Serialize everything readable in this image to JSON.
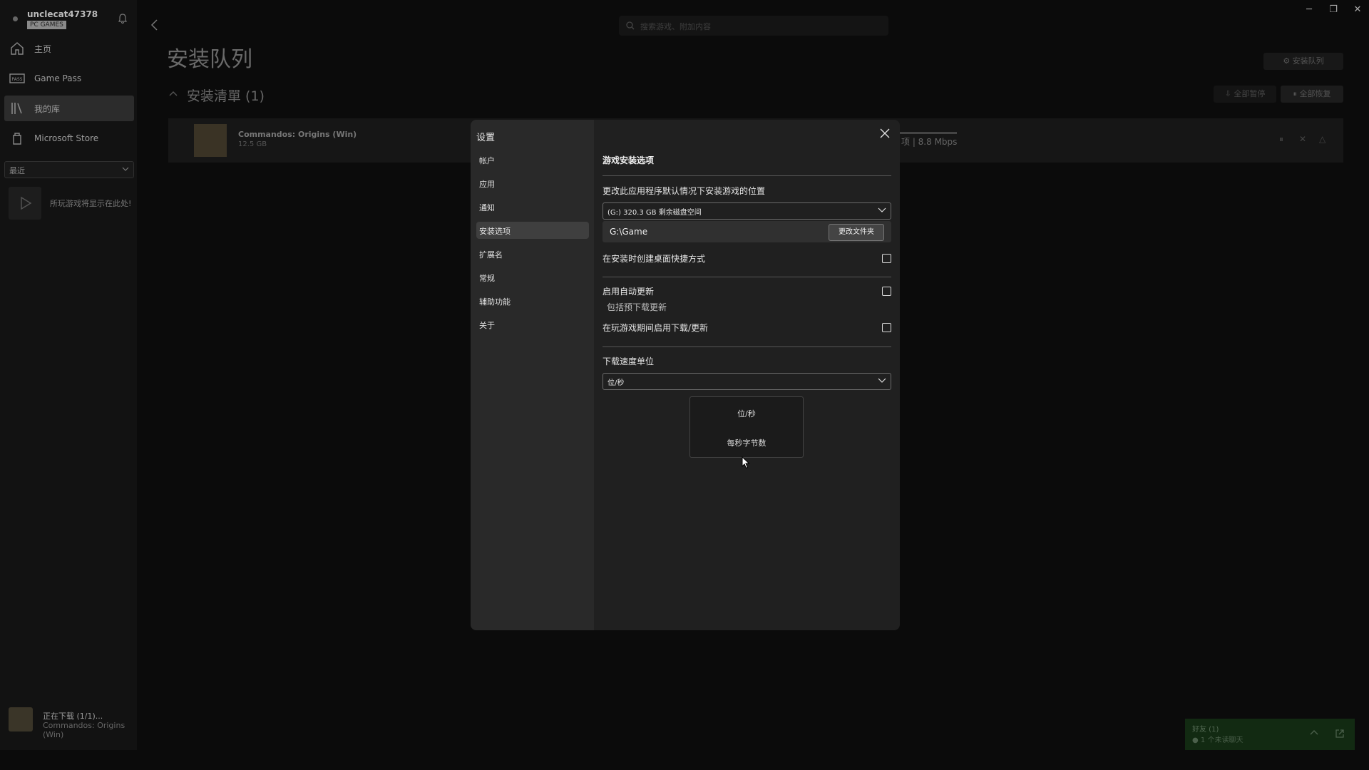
{
  "user": {
    "name": "unclecat47378",
    "badge": "PC GAMES"
  },
  "sidebar": {
    "items": [
      {
        "label": "主页",
        "icon": "home-icon"
      },
      {
        "label": "Game Pass",
        "icon": "game-pass-icon"
      },
      {
        "label": "我的库",
        "icon": "library-icon"
      },
      {
        "label": "Microsoft Store",
        "icon": "store-icon"
      }
    ],
    "recent_label": "最近",
    "recent_text": "所玩游戏将显示在此处!",
    "downloading_title": "正在下载 (1/1)...",
    "downloading_sub": "Commandos: Origins (Win)"
  },
  "header": {
    "search_placeholder": "搜索游戏、附加内容",
    "minimize": "─",
    "restore": "❐",
    "close": "✕"
  },
  "main": {
    "title": "安装队列",
    "queue_options": "安装队列",
    "list_title": "安装清單 (1)",
    "pause_all": "全部暂停",
    "resume_all": "全部恢复",
    "item": {
      "name": "Commandos: Origins (Win)",
      "size": "12.5 GB",
      "speed": "项 | 8.8 Mbps"
    }
  },
  "friends": {
    "title": "好友 (1)",
    "status": "● 1 个未读聊天"
  },
  "settings": {
    "title": "设置",
    "nav": [
      "帐户",
      "应用",
      "通知",
      "安装选项",
      "扩展名",
      "常规",
      "辅助功能",
      "关于"
    ],
    "active_index": 3,
    "section_title": "游戏安装选项",
    "location_label": "更改此应用程序默认情况下安装游戏的位置",
    "drive_value": "(G:) 320.3 GB 剩余磁盘空间",
    "path": "G:\\Game",
    "change_folder": "更改文件夹",
    "shortcut_label": "在安装时创建桌面快捷方式",
    "auto_update_label": "启用自动更新",
    "preload_label": "包括预下载更新",
    "play_download_label": "在玩游戏期间启用下载/更新",
    "speed_unit_label": "下载速度单位",
    "speed_unit_value": "位/秒",
    "speed_unit_options": [
      "位/秒",
      "每秒字节数"
    ],
    "checks": {
      "shortcut": false,
      "auto_update": false,
      "play_download": false
    }
  }
}
